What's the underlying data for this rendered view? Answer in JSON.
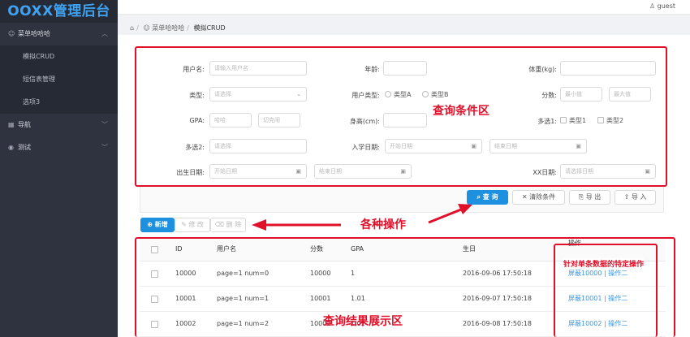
{
  "app": {
    "logo": "OOXX管理后台",
    "user": "guest"
  },
  "sidebar": {
    "group1": {
      "label": "菜单哈哈哈",
      "items": [
        {
          "label": "模拟CRUD"
        },
        {
          "label": "短信表管理"
        },
        {
          "label": "选项3"
        }
      ]
    },
    "nav": {
      "label": "导航"
    },
    "test": {
      "label": "测试"
    }
  },
  "breadcrumb": {
    "home_icon": "home-icon",
    "level1": "菜单哈哈哈",
    "level2": "模拟CRUD",
    "sep": "/"
  },
  "form": {
    "username": {
      "label": "用户名:",
      "placeholder": "请输入用户名"
    },
    "age": {
      "label": "年龄:"
    },
    "weight": {
      "label": "体重(kg):"
    },
    "type": {
      "label": "类型:",
      "placeholder": "请选择"
    },
    "user_type": {
      "label": "用户类型:",
      "options": [
        "类型A",
        "类型B"
      ]
    },
    "score": {
      "label": "分数:",
      "min": "最小值",
      "max": "最大值"
    },
    "gpa": {
      "label": "GPA:",
      "a": "哈哈",
      "b": "切克闹"
    },
    "height": {
      "label": "身高(cm):"
    },
    "multi1": {
      "label": "多选1:",
      "options": [
        "类型1",
        "类型2"
      ]
    },
    "multi2": {
      "label": "多选2:",
      "placeholder": "请选择"
    },
    "entry_date": {
      "label": "入学日期:",
      "start": "开始日期",
      "end": "结束日期"
    },
    "birth_date": {
      "label": "出生日期:",
      "start": "开始日期",
      "end": "结束日期"
    },
    "xx_date": {
      "label": "XX日期:",
      "placeholder": "请选择日期"
    }
  },
  "actions": {
    "query": "查 询",
    "clear": "清除条件",
    "export": "导 出",
    "import": "导 入"
  },
  "toolbar": {
    "add": "新增",
    "edit": "修 改",
    "delete": "删 除"
  },
  "annotations": {
    "query_area": "查询条件区",
    "ops": "各种操作",
    "result_area": "查询结果展示区",
    "row_ops": "针对单条数据的特定操作"
  },
  "table": {
    "headers": [
      "ID",
      "用户名",
      "分数",
      "GPA",
      "生日",
      "操作"
    ],
    "rows": [
      {
        "id": "10000",
        "user": "page=1 num=0",
        "score": "10000",
        "gpa": "1",
        "birthday": "2016-09-06 17:50:18",
        "op": "屏蔽10000 | 操作二"
      },
      {
        "id": "10001",
        "user": "page=1 num=1",
        "score": "10001",
        "gpa": "1.01",
        "birthday": "2016-09-07 17:50:18",
        "op": "屏蔽10001 | 操作二"
      },
      {
        "id": "10002",
        "user": "page=1 num=2",
        "score": "10002",
        "gpa": "1.02",
        "birthday": "2016-09-08 17:50:18",
        "op": "屏蔽10002 | 操作二"
      }
    ]
  }
}
